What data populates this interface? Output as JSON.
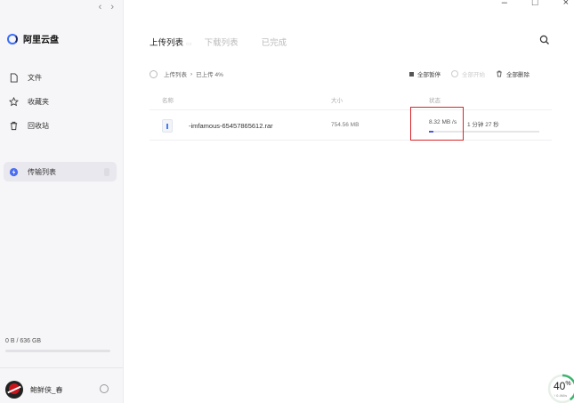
{
  "nav": {
    "back_glyph": "‹",
    "forward_glyph": "›"
  },
  "brand": {
    "name": "阿里云盘",
    "logo_icon": "aliyun-drive-logo-icon"
  },
  "sidebar": {
    "items": [
      {
        "label": "文件",
        "icon": "file-icon"
      },
      {
        "label": "收藏夹",
        "icon": "star-icon"
      },
      {
        "label": "回收站",
        "icon": "trash-icon"
      },
      {
        "label": "传输列表",
        "icon": "lightning-icon"
      }
    ],
    "storage_text": "0 B / 636 GB",
    "storage_used_fraction": 0
  },
  "user": {
    "name": "鲍鲜侠_春"
  },
  "window_controls": {
    "minimize": "–",
    "maximize": "□",
    "close": "×"
  },
  "tabs": [
    {
      "label": "上传列表",
      "active": true
    },
    {
      "label": "下载列表",
      "active": false
    },
    {
      "label": "已完成",
      "active": false
    }
  ],
  "breadcrumb": {
    "root": "上传列表",
    "separator": "›",
    "current": "已上传 4%"
  },
  "actions": {
    "pause_all": "全部暂停",
    "start_all": "全部开始",
    "delete_all": "全部删除"
  },
  "table": {
    "headers": {
      "name": "名称",
      "size": "大小",
      "status": "状态"
    },
    "rows": [
      {
        "name": "-imfamous-65457865612.rar",
        "size": "754.56 MB",
        "speed": "8.32 MB /s",
        "remaining": "1 分钟 27 秒",
        "progress_fraction": 0.04
      }
    ]
  },
  "overall": {
    "percent": "40",
    "unit": "%",
    "sub": "↑ 0.4M/s"
  },
  "colors": {
    "accent": "#4a5bd8",
    "highlight_box": "#d6272a",
    "ring": "#3cb46e"
  }
}
